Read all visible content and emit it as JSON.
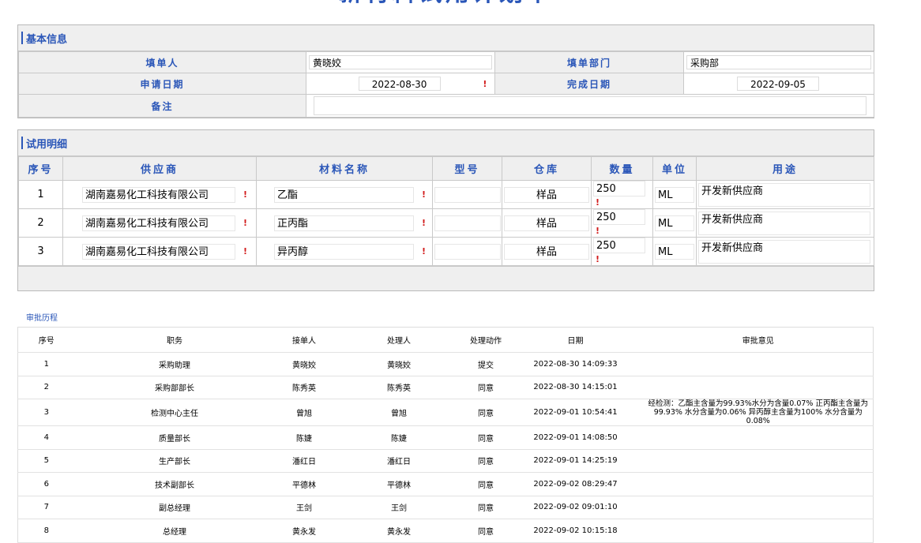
{
  "page": {
    "title": "新材料试用计划单"
  },
  "basic": {
    "section_title": "基本信息",
    "filler_label": "填单人",
    "filler_value": "黄晓姣",
    "dept_label": "填单部门",
    "dept_value": "采购部",
    "apply_date_label": "申请日期",
    "apply_date_value": "2022-08-30",
    "finish_date_label": "完成日期",
    "finish_date_value": "2022-09-05",
    "remark_label": "备注",
    "remark_value": "",
    "required_mark": "!"
  },
  "detail": {
    "section_title": "试用明细",
    "headers": [
      "序号",
      "供应商",
      "材料名称",
      "型号",
      "仓库",
      "数量",
      "单位",
      "用途"
    ],
    "rows": [
      {
        "no": "1",
        "supplier": "湖南嘉易化工科技有限公司",
        "material": "乙酯",
        "model": "",
        "warehouse": "样品",
        "qty": "250",
        "unit": "ML",
        "usage": "开发新供应商"
      },
      {
        "no": "2",
        "supplier": "湖南嘉易化工科技有限公司",
        "material": "正丙酯",
        "model": "",
        "warehouse": "样品",
        "qty": "250",
        "unit": "ML",
        "usage": "开发新供应商"
      },
      {
        "no": "3",
        "supplier": "湖南嘉易化工科技有限公司",
        "material": "异丙醇",
        "model": "",
        "warehouse": "样品",
        "qty": "250",
        "unit": "ML",
        "usage": "开发新供应商"
      }
    ]
  },
  "history": {
    "title": "审批历程",
    "headers": [
      "序号",
      "职务",
      "接单人",
      "处理人",
      "处理动作",
      "日期",
      "审批意见"
    ],
    "rows": [
      {
        "no": "1",
        "role": "采购助理",
        "receiver": "黄晓姣",
        "handler": "黄晓姣",
        "action": "提交",
        "date": "2022-08-30 14:09:33",
        "opinion": ""
      },
      {
        "no": "2",
        "role": "采购部部长",
        "receiver": "陈秀英",
        "handler": "陈秀英",
        "action": "同意",
        "date": "2022-08-30 14:15:01",
        "opinion": ""
      },
      {
        "no": "3",
        "role": "检测中心主任",
        "receiver": "曾旭",
        "handler": "曾旭",
        "action": "同意",
        "date": "2022-09-01 10:54:41",
        "opinion": "经检测：乙酯主含量为99.93%水分为含量0.07% 正丙酯主含量为99.93% 水分含量为0.06% 异丙醇主含量为100% 水分含量为0.08%"
      },
      {
        "no": "4",
        "role": "质量部长",
        "receiver": "陈婕",
        "handler": "陈婕",
        "action": "同意",
        "date": "2022-09-01 14:08:50",
        "opinion": ""
      },
      {
        "no": "5",
        "role": "生产部长",
        "receiver": "潘红日",
        "handler": "潘红日",
        "action": "同意",
        "date": "2022-09-01 14:25:19",
        "opinion": ""
      },
      {
        "no": "6",
        "role": "技术副部长",
        "receiver": "平德林",
        "handler": "平德林",
        "action": "同意",
        "date": "2022-09-02 08:29:47",
        "opinion": ""
      },
      {
        "no": "7",
        "role": "副总经理",
        "receiver": "王剑",
        "handler": "王剑",
        "action": "同意",
        "date": "2022-09-02 09:01:10",
        "opinion": ""
      },
      {
        "no": "8",
        "role": "总经理",
        "receiver": "黄永发",
        "handler": "黄永发",
        "action": "同意",
        "date": "2022-09-02 10:15:18",
        "opinion": ""
      }
    ]
  }
}
